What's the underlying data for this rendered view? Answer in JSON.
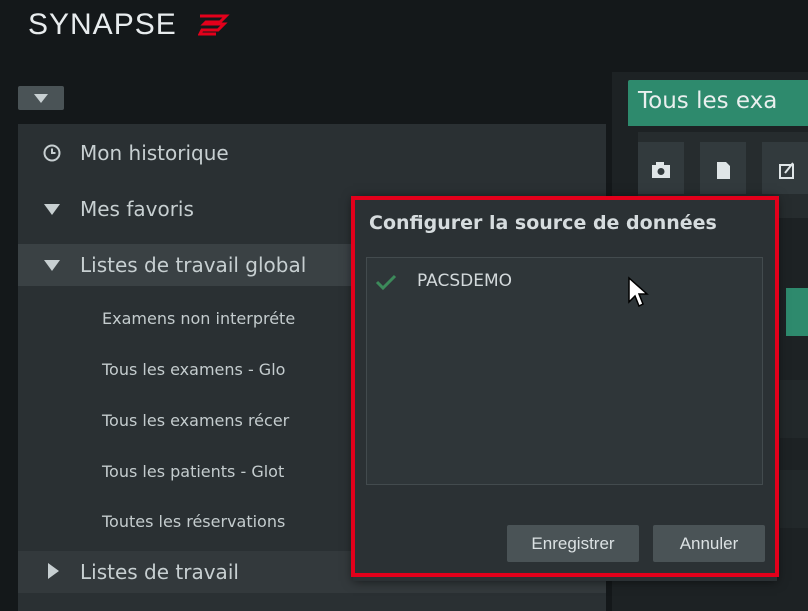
{
  "app": {
    "title": "SYNAPSE"
  },
  "sidebar": {
    "history_label": "Mon historique",
    "favorites_label": "Mes favoris",
    "global_lists_label": "Listes de travail global",
    "global_lists_items": [
      "Examens non interpréte",
      "Tous les examens - Glo",
      "Tous les examens récer",
      "Tous les patients - Glot",
      "Toutes les réservations"
    ],
    "worklists_label": "Listes de travail"
  },
  "main": {
    "tab_label": "Tous les exa"
  },
  "dialog": {
    "title": "Configurer la source de données",
    "sources": [
      {
        "label": "PACSDEMO",
        "checked": true
      }
    ],
    "save_label": "Enregistrer",
    "cancel_label": "Annuler"
  },
  "colors": {
    "accent": "#2e8a6d",
    "highlight": "#e3001b",
    "brand_mark": "#e3001b"
  }
}
